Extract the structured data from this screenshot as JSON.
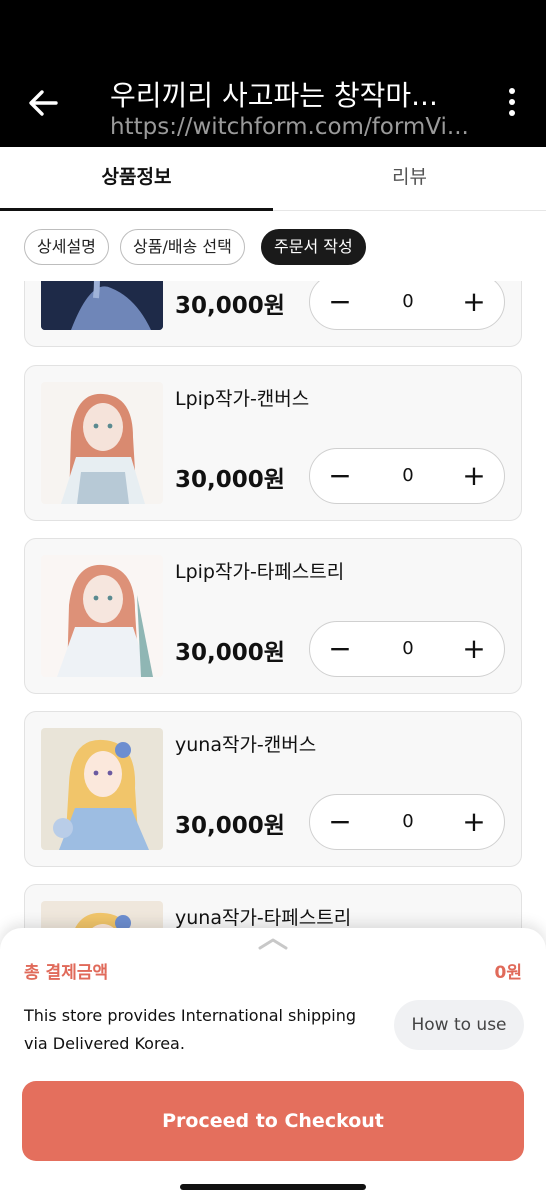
{
  "appbar": {
    "title": "우리끼리 사고파는 창작마...",
    "url": "https://witchform.com/formVi..."
  },
  "tabs": [
    {
      "label": "상품정보",
      "active": true
    },
    {
      "label": "리뷰",
      "active": false
    }
  ],
  "chips": [
    {
      "label": "상세설명",
      "active": false
    },
    {
      "label": "상품/배송 선택",
      "active": false
    },
    {
      "label": "주문서 작성",
      "active": true
    }
  ],
  "products": [
    {
      "name": "",
      "price": "30,000원",
      "qty": "0"
    },
    {
      "name": "Lpip작가-캔버스",
      "price": "30,000원",
      "qty": "0"
    },
    {
      "name": "Lpip작가-타페스트리",
      "price": "30,000원",
      "qty": "0"
    },
    {
      "name": "yuna작가-캔버스",
      "price": "30,000원",
      "qty": "0"
    },
    {
      "name": "yuna작가-타페스트리",
      "price": "",
      "qty": ""
    }
  ],
  "stepper": {
    "minus": "−",
    "plus": "+"
  },
  "sheet": {
    "total_label": "총 결제금액",
    "total_value": "0원",
    "shipping_text": "This store provides International shipping via Delivered Korea.",
    "how_to_use": "How to use",
    "checkout": "Proceed to Checkout"
  },
  "colors": {
    "accent": "#e46f5d",
    "total": "#e06a5a"
  }
}
